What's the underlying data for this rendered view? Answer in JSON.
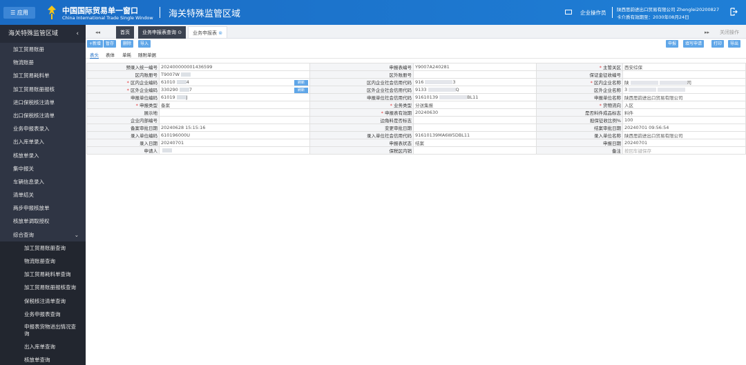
{
  "top": {
    "app_label": "☰ 应用",
    "brand_cn": "中国国际贸易单一窗口",
    "brand_en": "China International Trade Single Window",
    "system": "海关特殊监管区域",
    "operator": "企业操作员",
    "company": "陕西思韵进出口贸易有限公司 Zhenglei20200827",
    "card_expiry": "卡介质有效期至：2030年08月24日"
  },
  "sidebar": {
    "title": "海关特殊监管区域",
    "items": [
      "加工贸易账册",
      "物流账册",
      "加工贸易耗料单",
      "加工贸易账册报核",
      "进口保税核注清单",
      "出口保税核注清单",
      "业务申报表录入",
      "出入库单录入",
      "核放单录入",
      "集中报关",
      "车辆信息录入",
      "清单结关",
      "两步申报核放单",
      "核放单调取授权"
    ],
    "group": "综合查询",
    "sub": [
      "加工贸易账册查询",
      "物流账册查询",
      "加工贸易耗料单查询",
      "加工贸易账册报核查询",
      "保税核注清单查询",
      "业务申报表查询",
      "申报表货物进出情况查询",
      "出入库单查询",
      "核放单查询"
    ]
  },
  "tabs": {
    "home": "首页",
    "t1": "业务申报表查询",
    "t2": "业务申报表",
    "close": "关闭操作"
  },
  "toolbar": {
    "new": "+新增",
    "temp": "暂存",
    "del": "删除",
    "imp": "导入",
    "declare": "申报",
    "filing": "填写申请",
    "print": "打印",
    "export": "导出"
  },
  "subtabs": [
    "表头",
    "表体",
    "单耗",
    "随附单据"
  ],
  "form": {
    "r1": [
      "预录入统一编号",
      "202400000001436599",
      "申报表编号",
      "Y9007A240281",
      "主管关区",
      "西安综保"
    ],
    "r2": [
      "区内账册号",
      "T9007W",
      "区外账册号",
      "",
      "保证金征收编号",
      ""
    ],
    "r3": [
      "区内企业编码",
      "61010",
      "区内企业社会信用代码",
      "916",
      "区内企业名称",
      "陕"
    ],
    "r3v": [
      "4",
      "3",
      "司"
    ],
    "r4": [
      "区外企业编码",
      "330290",
      "区外企业社会信用代码",
      "9133",
      "区外企业名称",
      "3"
    ],
    "r4v": [
      "7",
      "Q",
      ""
    ],
    "r5": [
      "申报单位编码",
      "61019",
      "申报单位社会信用代码",
      "91610139",
      "申报单位名称",
      "陕西思韵进出口贸易有限公司"
    ],
    "r5v": [
      "J",
      "BL11",
      ""
    ],
    "r6": [
      "申报类型",
      "备案",
      "业务类型",
      "分送集报",
      "货物流向",
      "入区"
    ],
    "r7": [
      "展示地",
      "",
      "申报表有效期",
      "20240630",
      "是否料件成品标志",
      "料件"
    ],
    "r8": [
      "企业内部编号",
      "",
      "边角料是否标志",
      "",
      "担保征收比例%",
      "100"
    ],
    "r9": [
      "备案审批日期",
      "20240628 15:15:16",
      "变更审批日期",
      "",
      "结案审批日期",
      "20240701 09:56:54"
    ],
    "r10": [
      "录入单位编码",
      "610196000U",
      "录入单位社会信用代码",
      "91610139MA6W5DBL11",
      "录入单位名称",
      "陕西思韵进出口贸易有限公司"
    ],
    "r11": [
      "录入日期",
      "20240701",
      "申报表状态",
      "结案",
      "申报日期",
      "20240701"
    ],
    "r12": [
      "申请人",
      "",
      "保税区内销",
      "",
      "备注",
      "按回车键保存"
    ],
    "check_label": "刷新"
  }
}
